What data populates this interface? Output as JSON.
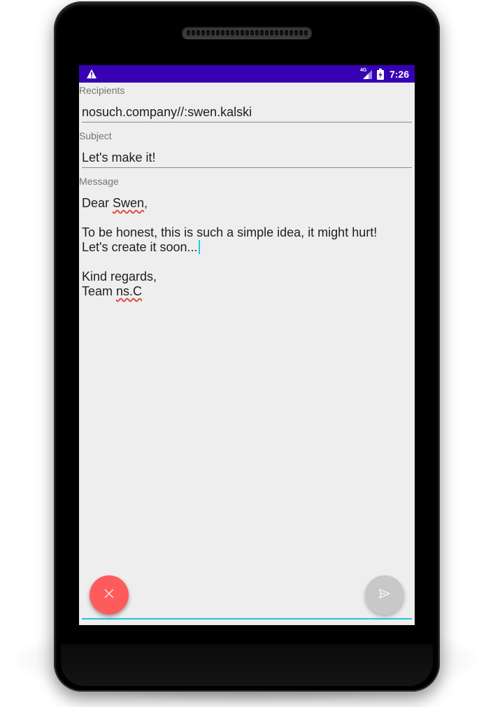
{
  "status_bar": {
    "alert_icon": "warning-icon",
    "network_label": "4G",
    "signal_icon": "cell-signal-icon",
    "battery_icon": "battery-charging-icon",
    "time": "7:26",
    "background_color": "#3700b3"
  },
  "form": {
    "recipients": {
      "label": "Recipients",
      "value": "nosuch.company//:swen.kalski"
    },
    "subject": {
      "label": "Subject",
      "value": "Let's make it!"
    },
    "message": {
      "label": "Message",
      "lines": [
        "Dear ",
        "Swen",
        ",",
        "To be honest, this is such a simple idea, it might hurt!",
        "Let's create it soon...",
        "Kind regards,",
        "Team ",
        "ns.C"
      ]
    }
  },
  "actions": {
    "discard_icon": "close-icon",
    "send_icon": "send-icon",
    "discard_color": "#fe5c5c",
    "send_color": "#c8c8c8",
    "accent_color": "#26c6da"
  }
}
